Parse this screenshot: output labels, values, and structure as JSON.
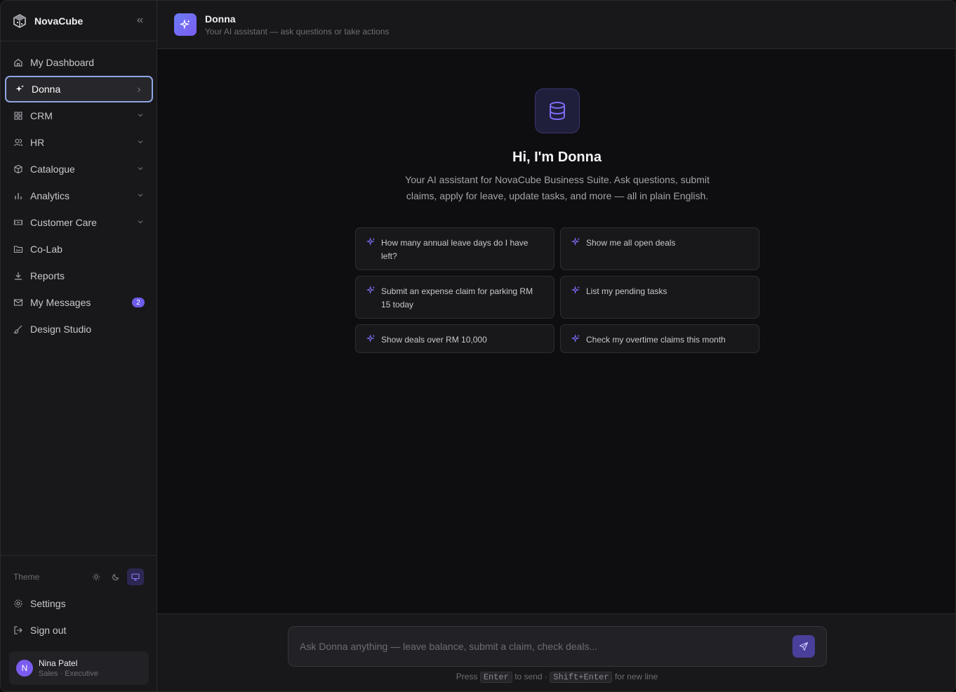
{
  "brand": {
    "name": "NovaCube"
  },
  "nav": {
    "items": [
      {
        "label": "My Dashboard",
        "icon": "home-icon"
      },
      {
        "label": "Donna",
        "icon": "sparkle-icon",
        "active": true
      },
      {
        "label": "CRM",
        "icon": "grid-icon"
      },
      {
        "label": "HR",
        "icon": "users-icon"
      },
      {
        "label": "Catalogue",
        "icon": "package-icon"
      },
      {
        "label": "Analytics",
        "icon": "bar-chart-icon"
      },
      {
        "label": "Customer Care",
        "icon": "ticket-icon"
      },
      {
        "label": "Co-Lab",
        "icon": "folder-icon"
      },
      {
        "label": "Reports",
        "icon": "download-icon"
      },
      {
        "label": "My Messages",
        "icon": "mail-icon",
        "badge": "2"
      },
      {
        "label": "Design Studio",
        "icon": "brush-icon"
      }
    ]
  },
  "theme": {
    "label": "Theme",
    "options": [
      "light",
      "dark",
      "system"
    ],
    "selected": "system"
  },
  "bottom": {
    "settings": "Settings",
    "sign_out": "Sign out"
  },
  "user": {
    "initial": "N",
    "name": "Nina Patel",
    "role": "Sales · Executive"
  },
  "header": {
    "title": "Donna",
    "subtitle": "Your AI assistant — ask questions or take actions"
  },
  "hero": {
    "title": "Hi, I'm Donna",
    "description": "Your AI assistant for NovaCube Business Suite. Ask questions, submit claims, apply for leave, update tasks, and more — all in plain English."
  },
  "suggestions": [
    "How many annual leave days do I have left?",
    "Show me all open deals",
    "Submit an expense claim for parking RM 15 today",
    "List my pending tasks",
    "Show deals over RM 10,000",
    "Check my overtime claims this month"
  ],
  "composer": {
    "placeholder": "Ask Donna anything — leave balance, submit a claim, check deals...",
    "hint_press": "Press",
    "hint_enter": "Enter",
    "hint_to_send": "to send",
    "hint_sep": "·",
    "hint_shift": "Shift+Enter",
    "hint_newline": "for new line"
  },
  "colors": {
    "accent": "#7c5cf0",
    "active_border": "#8fa6e3",
    "background": "#0e0e10",
    "panel": "#18181b"
  }
}
